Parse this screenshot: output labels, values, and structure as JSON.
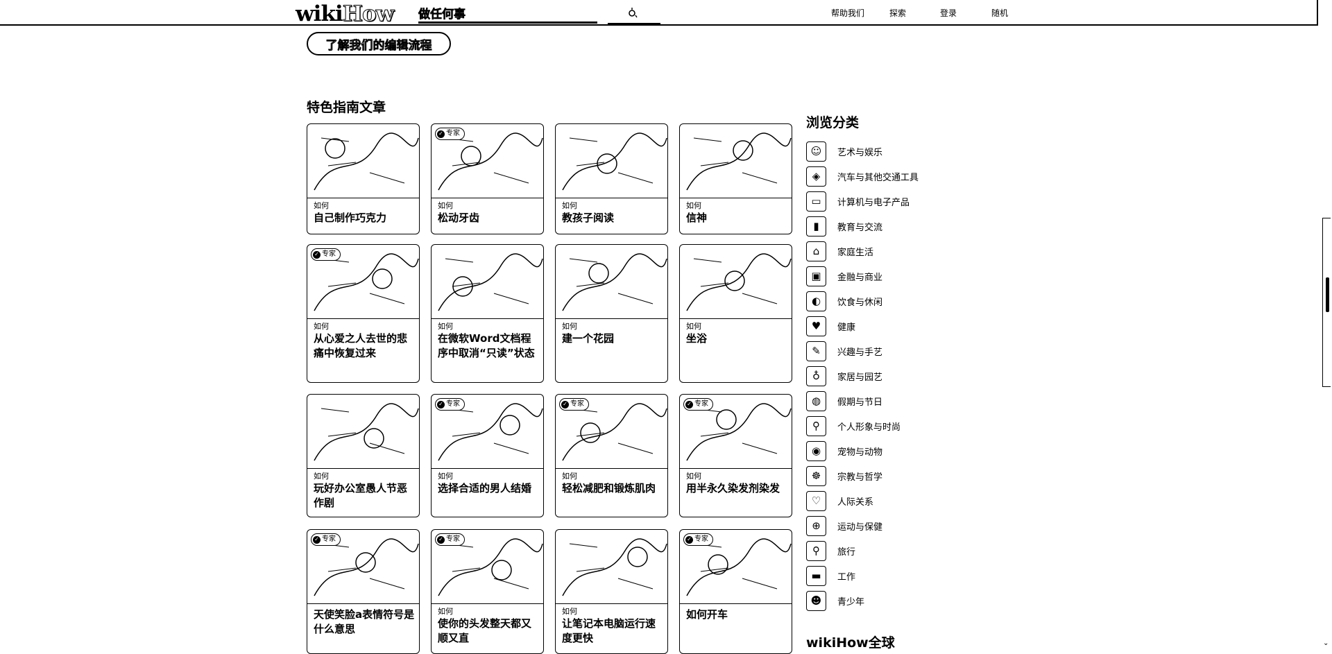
{
  "header": {
    "logo_wiki": "wiki",
    "logo_how": "How",
    "search_placeholder": "做任何事",
    "nav": [
      "帮助我们",
      "探索",
      "登录",
      "随机"
    ]
  },
  "editorial_button": "了解我们的编辑流程",
  "featured": {
    "title": "特色指南文章",
    "how_prefix": "如何",
    "expert_label": "专家",
    "cards": [
      {
        "title": "自己制作巧克力",
        "how": true,
        "expert": false
      },
      {
        "title": "松动牙齿",
        "how": true,
        "expert": true
      },
      {
        "title": "教孩子阅读",
        "how": true,
        "expert": false
      },
      {
        "title": "信神",
        "how": true,
        "expert": false
      },
      {
        "title": "从心爱之人去世的悲痛中恢复过来",
        "how": true,
        "expert": true
      },
      {
        "title": "在微软Word文档程序中取消“只读”状态",
        "how": true,
        "expert": false
      },
      {
        "title": "建一个花园",
        "how": true,
        "expert": false
      },
      {
        "title": "坐浴",
        "how": true,
        "expert": false
      },
      {
        "title": "玩好办公室愚人节恶作剧",
        "how": true,
        "expert": false
      },
      {
        "title": "选择合适的男人结婚",
        "how": true,
        "expert": true
      },
      {
        "title": "轻松减肥和锻炼肌肉",
        "how": true,
        "expert": true
      },
      {
        "title": "用半永久染发剂染发",
        "how": true,
        "expert": true
      },
      {
        "title": "天使笑脸a表情符号是什么意思",
        "how": false,
        "expert": true
      },
      {
        "title": "使你的头发整天都又顺又直",
        "how": true,
        "expert": true
      },
      {
        "title": "让笔记本电脑运行速度更快",
        "how": true,
        "expert": false
      },
      {
        "title": "如何开车",
        "how": false,
        "expert": true
      }
    ]
  },
  "sidebar": {
    "title": "浏览分类",
    "categories": [
      {
        "label": "艺术与娱乐",
        "icon": "theater-mask-icon",
        "glyph": "☺"
      },
      {
        "label": "汽车与其他交通工具",
        "icon": "car-icon",
        "glyph": "◈"
      },
      {
        "label": "计算机与电子产品",
        "icon": "monitor-icon",
        "glyph": "▭"
      },
      {
        "label": "教育与交流",
        "icon": "book-icon",
        "glyph": "▮"
      },
      {
        "label": "家庭生活",
        "icon": "house-icon",
        "glyph": "⌂"
      },
      {
        "label": "金融与商业",
        "icon": "chart-icon",
        "glyph": "▣"
      },
      {
        "label": "饮食与休闲",
        "icon": "utensils-icon",
        "glyph": "◐"
      },
      {
        "label": "健康",
        "icon": "heart-icon",
        "glyph": "♥"
      },
      {
        "label": "兴趣与手艺",
        "icon": "pencil-icon",
        "glyph": "✎"
      },
      {
        "label": "家居与园艺",
        "icon": "watering-can-icon",
        "glyph": "♁"
      },
      {
        "label": "假期与节日",
        "icon": "balloon-icon",
        "glyph": "◍"
      },
      {
        "label": "个人形象与时尚",
        "icon": "mirror-icon",
        "glyph": "⚲"
      },
      {
        "label": "宠物与动物",
        "icon": "fish-icon",
        "glyph": "◉"
      },
      {
        "label": "宗教与哲学",
        "icon": "lotus-icon",
        "glyph": "☸"
      },
      {
        "label": "人际关系",
        "icon": "hearts-icon",
        "glyph": "♡"
      },
      {
        "label": "运动与保健",
        "icon": "ball-icon",
        "glyph": "⊕"
      },
      {
        "label": "旅行",
        "icon": "map-pin-icon",
        "glyph": "⚲"
      },
      {
        "label": "工作",
        "icon": "briefcase-icon",
        "glyph": "▬"
      },
      {
        "label": "青少年",
        "icon": "teen-face-icon",
        "glyph": "☻"
      }
    ],
    "global_title": "wikiHow全球"
  }
}
